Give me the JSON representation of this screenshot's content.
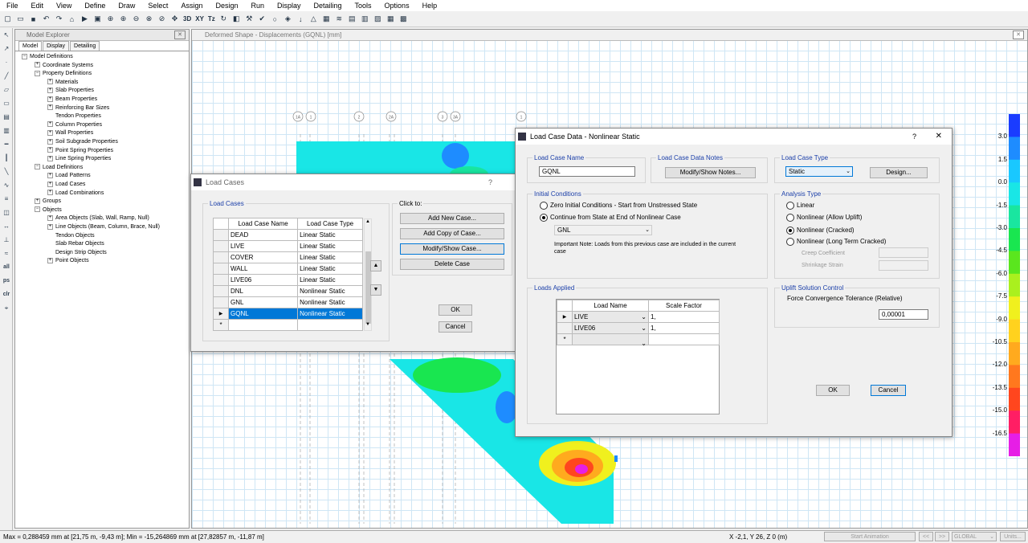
{
  "menu": [
    "File",
    "Edit",
    "View",
    "Define",
    "Draw",
    "Select",
    "Assign",
    "Design",
    "Run",
    "Display",
    "Detailing",
    "Tools",
    "Options",
    "Help"
  ],
  "toolbar": {
    "label_3d": "3D",
    "label_xy": "XY",
    "label_tz": "Tz"
  },
  "left_tools": {
    "label_all": "all",
    "label_ps": "ps",
    "label_clr": "clr"
  },
  "explorer": {
    "title": "Model Explorer",
    "tabs": [
      "Model",
      "Display",
      "Detailing"
    ],
    "items": [
      "Model Definitions",
      "Coordinate Systems",
      "Property Definitions",
      "Materials",
      "Slab Properties",
      "Beam Properties",
      "Reinforcing Bar Sizes",
      "Tendon Properties",
      "Column Properties",
      "Wall Properties",
      "Soil Subgrade Properties",
      "Point Spring Properties",
      "Line Spring Properties",
      "Load Definitions",
      "Load Patterns",
      "Load Cases",
      "Load Combinations",
      "Groups",
      "Objects",
      "Area Objects (Slab, Wall, Ramp, Null)",
      "Line Objects (Beam, Column, Brace, Null)",
      "Tendon Objects",
      "Slab Rebar Objects",
      "Design Strip Objects",
      "Point Objects"
    ]
  },
  "view": {
    "title": "Deformed Shape - Displacements (GQNL)  [mm]",
    "grid_bubbles": [
      "1A",
      "1",
      "2",
      "2A",
      "3",
      "3A",
      "1"
    ]
  },
  "legend": {
    "labels": [
      "3.0",
      "1.5",
      "0.0",
      "-1.5",
      "-3.0",
      "-4.5",
      "-6.0",
      "-7.5",
      "-9.0",
      "-10.5",
      "-12.0",
      "-13.5",
      "-15.0",
      "-16.5"
    ],
    "colors": [
      "#1a3cff",
      "#1e8cff",
      "#19c8ff",
      "#19e6e6",
      "#19e6a0",
      "#19e650",
      "#5ae61e",
      "#aaf01e",
      "#f0f01e",
      "#ffd21e",
      "#ffaa1e",
      "#ff781e",
      "#ff461e",
      "#ff1e64",
      "#e61ee6"
    ]
  },
  "status": {
    "minmax": "Max = 0,288459 mm at [21,75 m, -9,43 m];  Min = -15,264869 mm at [27,82857 m, -11,87 m]",
    "coords": "X -2,1,  Y 26,  Z 0  (m)",
    "start_animation": "Start Animation",
    "prev": "<<",
    "next": ">>",
    "global": "GLOBAL",
    "units": "Units..."
  },
  "load_cases_dialog": {
    "title": "Load Cases",
    "help": "?",
    "group_label": "Load Cases",
    "click_label": "Click to:",
    "col_name": "Load Case Name",
    "col_type": "Load Case Type",
    "rows": [
      {
        "name": "DEAD",
        "type": "Linear Static"
      },
      {
        "name": "LIVE",
        "type": "Linear Static"
      },
      {
        "name": "COVER",
        "type": "Linear Static"
      },
      {
        "name": "WALL",
        "type": "Linear Static"
      },
      {
        "name": "LIVE06",
        "type": "Linear Static"
      },
      {
        "name": "DNL",
        "type": "Nonlinear Static"
      },
      {
        "name": "GNL",
        "type": "Nonlinear Static"
      },
      {
        "name": "GQNL",
        "type": "Nonlinear Static"
      }
    ],
    "new_row_marker": "*",
    "btn_add_new": "Add New Case...",
    "btn_add_copy": "Add Copy of Case...",
    "btn_modify": "Modify/Show Case...",
    "btn_delete": "Delete Case",
    "btn_ok": "OK",
    "btn_cancel": "Cancel"
  },
  "lcd_dialog": {
    "title": "Load Case Data - Nonlinear Static",
    "help": "?",
    "close": "✕",
    "name_label": "Load Case Name",
    "name_value": "GQNL",
    "notes_label": "Load Case Data Notes",
    "btn_notes": "Modify/Show Notes...",
    "type_label": "Load Case Type",
    "type_value": "Static",
    "btn_design": "Design...",
    "ic_label": "Initial Conditions",
    "ic_zero": "Zero Initial Conditions - Start from Unstressed State",
    "ic_continue": "Continue from State at End of Nonlinear Case",
    "ic_case": "GNL",
    "ic_note": "Important Note:  Loads from this previous case are included in the current case",
    "at_label": "Analysis Type",
    "at_linear": "Linear",
    "at_uplift": "Nonlinear (Allow Uplift)",
    "at_cracked": "Nonlinear (Cracked)",
    "at_longterm": "Nonlinear (Long Term Cracked)",
    "creep": "Creep Coefficient",
    "shrinkage": "Shrinkage Strain",
    "loads_label": "Loads Applied",
    "col_load_name": "Load Name",
    "col_scale": "Scale Factor",
    "loads": [
      {
        "name": "LIVE",
        "scale": "1,"
      },
      {
        "name": "LIVE06",
        "scale": "1,"
      }
    ],
    "new_row_marker": "*",
    "uplift_label": "Uplift Solution Control",
    "tolerance_label": "Force Convergence Tolerance (Relative)",
    "tolerance_value": "0,00001",
    "btn_ok": "OK",
    "btn_cancel": "Cancel"
  }
}
